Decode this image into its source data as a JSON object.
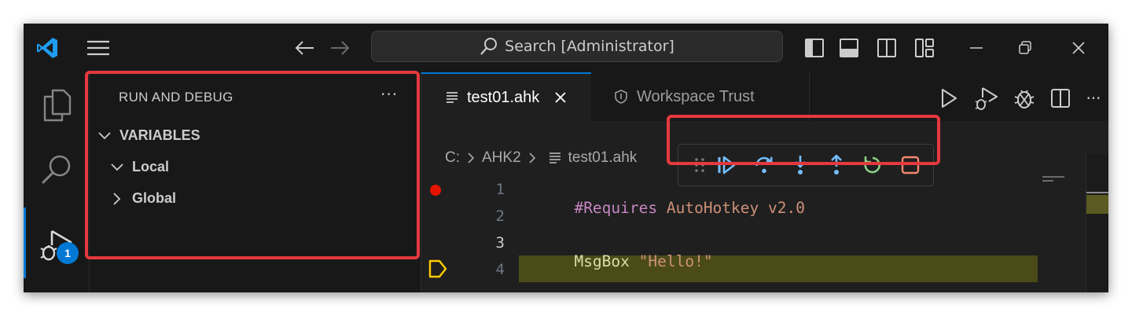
{
  "title_bar": {
    "search_placeholder": "Search [Administrator]",
    "icons": [
      "vscode-logo-icon",
      "menu-icon",
      "back-arrow-icon",
      "forward-arrow-icon",
      "search-icon",
      "toggle-primary-sidebar-icon",
      "toggle-panel-icon",
      "toggle-secondary-sidebar-icon",
      "customize-layout-icon",
      "minimize-icon",
      "restore-icon",
      "close-icon"
    ]
  },
  "activity_bar": {
    "items": [
      "explorer-icon",
      "search-icon",
      "run-debug-icon"
    ],
    "run_debug_badge": "1"
  },
  "sidebar": {
    "title": "RUN AND DEBUG",
    "more_actions": "···",
    "variables_section": "VARIABLES",
    "scopes": [
      {
        "label": "Local",
        "expanded": true
      },
      {
        "label": "Global",
        "expanded": false
      }
    ]
  },
  "editor": {
    "tabs": [
      {
        "label": "test01.ahk",
        "active": true
      },
      {
        "label": "Workspace Trust",
        "active": false
      }
    ],
    "breadcrumbs": [
      "C:",
      "AHK2",
      "test01.ahk"
    ],
    "lines": [
      {
        "number": "1",
        "tokens": [
          {
            "text": "#Requires ",
            "color": "#c586c0"
          },
          {
            "text": "AutoHotkey v2.0",
            "color": "#ce9178"
          }
        ],
        "breakpoint": true
      },
      {
        "number": "2",
        "tokens": []
      },
      {
        "number": "3",
        "tokens": [
          {
            "text": "MsgBox ",
            "color": "#dcdcaa"
          },
          {
            "text": "\"Hello!\"",
            "color": "#ce9178"
          }
        ],
        "current": true
      },
      {
        "number": "4",
        "tokens": []
      }
    ]
  },
  "debug_toolbar": {
    "buttons": [
      "continue",
      "step-over",
      "step-into",
      "step-out",
      "restart",
      "stop"
    ]
  },
  "colors": {
    "accent": "#0078d4",
    "breakpoint": "#e51400",
    "current_line_arrow": "#ffcc00",
    "highlight_border": "#e5393e",
    "debug_blue": "#75beff",
    "restart_green": "#89d185",
    "stop_red": "#f48771"
  }
}
